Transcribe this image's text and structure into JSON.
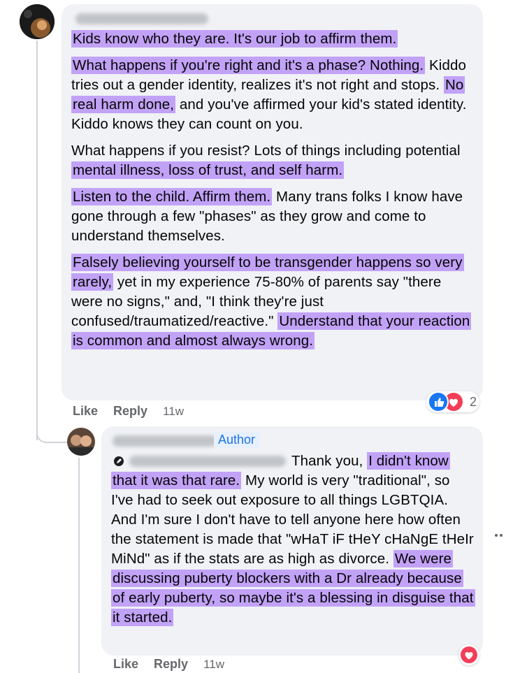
{
  "comment1": {
    "paragraphs": [
      [
        {
          "t": "Kids know who they are. It's our job to affirm them.",
          "h": true
        }
      ],
      [
        {
          "t": "What happens if you're right and it's a phase? Nothing.",
          "h": true
        },
        {
          "t": " Kiddo tries out a gender identity, realizes it's not right and stops. ",
          "h": false
        },
        {
          "t": "No real harm done,",
          "h": true
        },
        {
          "t": " and you've affirmed your kid's stated identity. Kiddo knows they can count on you.",
          "h": false
        }
      ],
      [
        {
          "t": "What happens if you resist? Lots of things including potential ",
          "h": false
        },
        {
          "t": "mental illness, loss of trust, and self harm.",
          "h": true
        }
      ],
      [
        {
          "t": "Listen to the child. Affirm them.",
          "h": true
        },
        {
          "t": " Many trans folks I know have gone through a few \"phases\" as they grow and come to understand themselves.",
          "h": false
        }
      ],
      [
        {
          "t": "Falsely believing yourself to be transgender happens so very rarely,",
          "h": true
        },
        {
          "t": " yet in my experience 75-80% of parents say \"there were no signs,\" and, \"I think they're just confused/traumatized/reactive.\" ",
          "h": false
        },
        {
          "t": "Understand that your reaction is common and almost always wrong.",
          "h": true
        }
      ]
    ],
    "actions": {
      "like": "Like",
      "reply": "Reply",
      "time": "11w"
    },
    "reaction_count": "2"
  },
  "comment2": {
    "author_badge": "Author",
    "paragraphs": [
      [
        {
          "t": "Thank you, ",
          "h": false
        },
        {
          "t": "I didn't know that it was that rare.",
          "h": true
        },
        {
          "t": " My world is very \"traditional\", so I've had to seek out exposure to all things LGBTQIA. And I'm sure I don't have to tell anyone here how often the statement is made that \"wHaT iF tHeY cHaNgE tHeIr MiNd\" as if the stats are as high as divorce. ",
          "h": false
        },
        {
          "t": "We were discussing puberty blockers with a Dr already because of early puberty, so maybe it's a blessing in disguise that it started.",
          "h": true
        }
      ]
    ],
    "actions": {
      "like": "Like",
      "reply": "Reply",
      "time": "11w"
    }
  },
  "colors": {
    "highlight": "#c2a2f7",
    "bubble": "#f0f2f5",
    "like_blue": "#1877f2",
    "love_red": "#f33e58"
  },
  "icons": {
    "like": "like-icon",
    "love": "love-icon",
    "more": "more-options-icon"
  }
}
